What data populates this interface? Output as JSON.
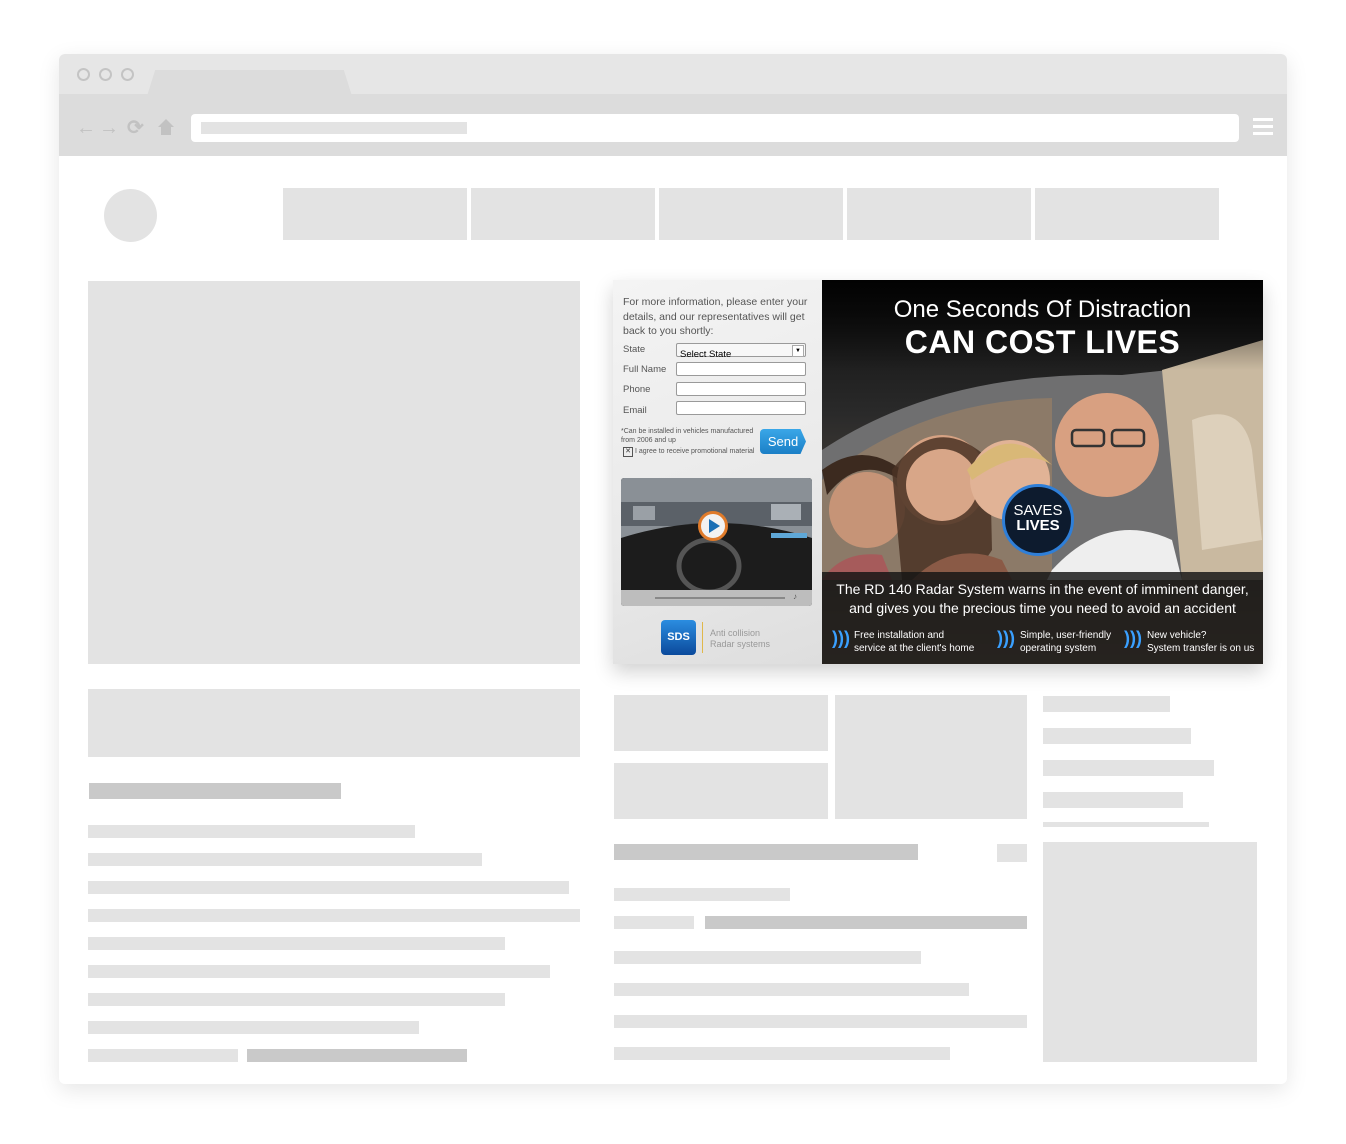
{
  "browser": {
    "nav_icons": [
      "back-arrow-icon",
      "forward-arrow-icon",
      "reload-icon",
      "home-icon",
      "menu-icon"
    ]
  },
  "ad": {
    "form": {
      "intro": "For more information, please enter your details, and our representatives will get back to you shortly:",
      "state_label": "State",
      "state_value": "Select State",
      "fullname_label": "Full Name",
      "phone_label": "Phone",
      "email_label": "Email",
      "footnote": "*Can be installed in vehicles manufactured from 2006 and up",
      "agree_label": "I agree to receive promotional material",
      "checkbox_mark": "✕",
      "send_label": "Send"
    },
    "brand": {
      "logo_text": "SDS",
      "tagline_line1": "Anti collision",
      "tagline_line2": "Radar systems"
    },
    "banner": {
      "headline_line1": "One Seconds Of Distraction",
      "headline_line2": "CAN COST LIVES",
      "badge_line1": "SAVES",
      "badge_line2": "LIVES",
      "body_line1": "The RD 140 Radar System warns in the event of imminent danger,",
      "body_line2": "and gives you the precious time you need to avoid an accident",
      "features": [
        {
          "line1": "Free installation and",
          "line2": "service at the client's home"
        },
        {
          "line1": "Simple, user-friendly",
          "line2": "operating system"
        },
        {
          "line1": "New vehicle?",
          "line2": "System transfer is on us"
        }
      ]
    },
    "colors": {
      "send_button": "#1b7fc6",
      "accent_blue": "#3aa0ff"
    }
  }
}
